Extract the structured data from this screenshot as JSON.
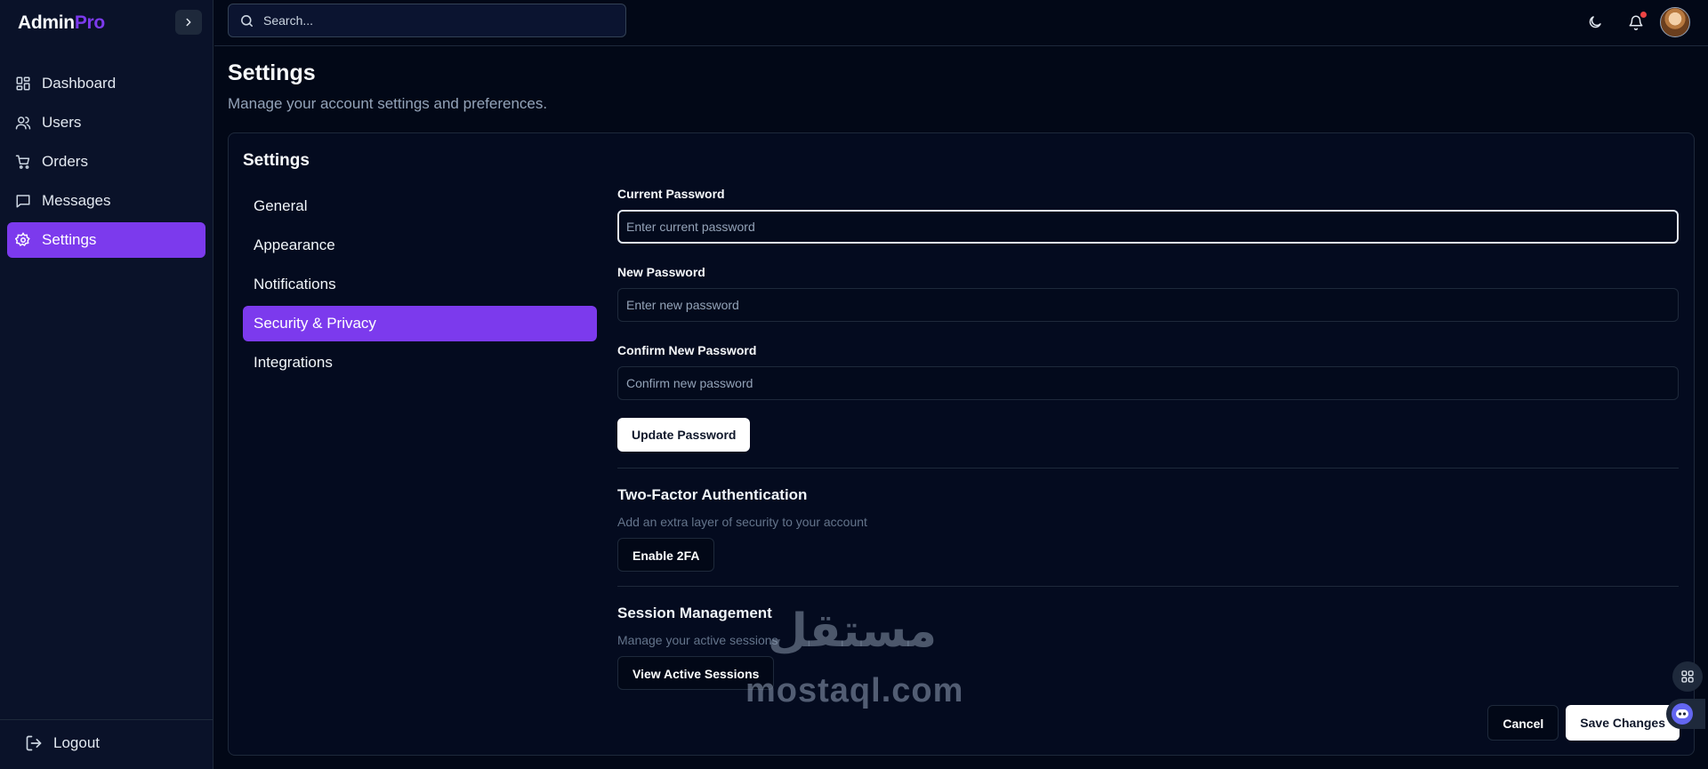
{
  "brand": {
    "main": "Admin",
    "accent": "Pro",
    "accent_color": "#7c3aed"
  },
  "sidebar": {
    "items": [
      {
        "label": "Dashboard",
        "icon": "dashboard-icon"
      },
      {
        "label": "Users",
        "icon": "users-icon"
      },
      {
        "label": "Orders",
        "icon": "cart-icon"
      },
      {
        "label": "Messages",
        "icon": "message-icon"
      },
      {
        "label": "Settings",
        "icon": "gear-icon",
        "active": true
      }
    ],
    "logout_label": "Logout"
  },
  "topbar": {
    "search_placeholder": "Search..."
  },
  "page": {
    "title": "Settings",
    "subtitle": "Manage your account settings and preferences."
  },
  "card": {
    "title": "Settings",
    "tabs": [
      {
        "label": "General"
      },
      {
        "label": "Appearance"
      },
      {
        "label": "Notifications"
      },
      {
        "label": "Security & Privacy",
        "active": true
      },
      {
        "label": "Integrations"
      }
    ]
  },
  "security": {
    "current_password": {
      "label": "Current Password",
      "placeholder": "Enter current password",
      "value": ""
    },
    "new_password": {
      "label": "New Password",
      "placeholder": "Enter new password",
      "value": ""
    },
    "confirm_password": {
      "label": "Confirm New Password",
      "placeholder": "Confirm new password",
      "value": ""
    },
    "update_button": "Update Password",
    "two_factor": {
      "title": "Two-Factor Authentication",
      "description": "Add an extra layer of security to your account",
      "button": "Enable 2FA"
    },
    "sessions": {
      "title": "Session Management",
      "description": "Manage your active sessions",
      "button": "View Active Sessions"
    }
  },
  "footer": {
    "cancel_label": "Cancel",
    "save_label": "Save Changes"
  },
  "watermark": {
    "arabic": "مستقل",
    "latin": "mostaql.com"
  },
  "colors": {
    "background": "#020817",
    "sidebar": "#0a1229",
    "accent": "#7c3aed",
    "notification_dot": "#ef4444"
  }
}
